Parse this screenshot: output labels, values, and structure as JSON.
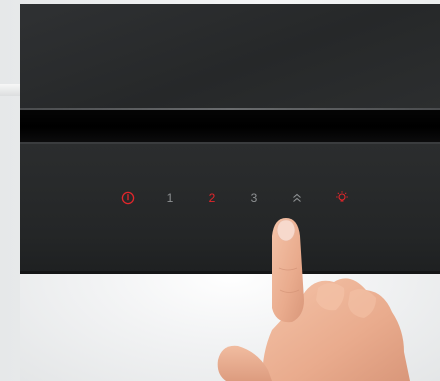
{
  "controls": {
    "power": {
      "icon": "power-icon",
      "color": "#e3262b"
    },
    "speed_1": {
      "label": "1",
      "color": "#8e9193"
    },
    "speed_2": {
      "label": "2",
      "color": "#e3262b"
    },
    "speed_3": {
      "label": "3",
      "color": "#8e9193"
    },
    "boost": {
      "icon": "double-chevron-up-icon",
      "color": "#8e9193"
    },
    "light": {
      "icon": "light-icon",
      "color": "#e3262b"
    }
  },
  "colors": {
    "hood": "#2a2c2e",
    "active_indicator": "#e3262b",
    "inactive_indicator": "#8e9193"
  }
}
